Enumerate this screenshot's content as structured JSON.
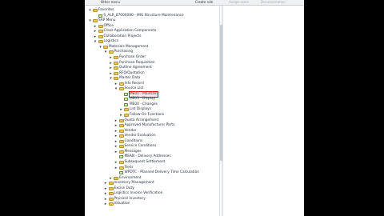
{
  "toolbar": {
    "buttons": [
      "Other menu",
      "Create role",
      "Assign users",
      "Documentation"
    ]
  },
  "tree": [
    {
      "label": "Favorites",
      "level": 0,
      "icon": "folder",
      "open": true
    },
    {
      "label": "S_ALR_87000080 - IMG Structure Maintenance",
      "level": 1,
      "icon": "transaction",
      "open": null
    },
    {
      "label": "SAP Menu",
      "level": 0,
      "icon": "folder",
      "open": true
    },
    {
      "label": "Office",
      "level": 1,
      "icon": "folder",
      "open": false
    },
    {
      "label": "Cross-Application Components",
      "level": 1,
      "icon": "folder",
      "open": false
    },
    {
      "label": "Collaboration Projects",
      "level": 1,
      "icon": "folder",
      "open": false
    },
    {
      "label": "Logistics",
      "level": 1,
      "icon": "folder",
      "open": true
    },
    {
      "label": "Materials Management",
      "level": 2,
      "icon": "folder",
      "open": true
    },
    {
      "label": "Purchasing",
      "level": 3,
      "icon": "folder",
      "open": true
    },
    {
      "label": "Purchase Order",
      "level": 4,
      "icon": "folder",
      "open": false
    },
    {
      "label": "Purchase Requisition",
      "level": 4,
      "icon": "folder",
      "open": false
    },
    {
      "label": "Outline Agreement",
      "level": 4,
      "icon": "folder",
      "open": false
    },
    {
      "label": "RFQ/Quotation",
      "level": 4,
      "icon": "folder",
      "open": false
    },
    {
      "label": "Master Data",
      "level": 4,
      "icon": "folder",
      "open": true
    },
    {
      "label": "Info Record",
      "level": 5,
      "icon": "folder",
      "open": false
    },
    {
      "label": "Source List",
      "level": 5,
      "icon": "folder",
      "open": true
    },
    {
      "label": "ME01 - Maintain",
      "level": 6,
      "icon": "transaction",
      "open": null,
      "selected": true
    },
    {
      "label": "ME03 - Display",
      "level": 6,
      "icon": "transaction",
      "open": null
    },
    {
      "label": "ME04 - Changes",
      "level": 6,
      "icon": "transaction",
      "open": null
    },
    {
      "label": "List Displays",
      "level": 6,
      "icon": "folder",
      "open": false
    },
    {
      "label": "Follow-On Functions",
      "level": 6,
      "icon": "folder",
      "open": false
    },
    {
      "label": "Quota Arrangement",
      "level": 5,
      "icon": "folder",
      "open": false
    },
    {
      "label": "Approved Manufacturer Parts",
      "level": 5,
      "icon": "folder",
      "open": false
    },
    {
      "label": "Vendor",
      "level": 5,
      "icon": "folder",
      "open": false
    },
    {
      "label": "Vendor Evaluation",
      "level": 5,
      "icon": "folder",
      "open": false
    },
    {
      "label": "Conditions",
      "level": 5,
      "icon": "folder",
      "open": false
    },
    {
      "label": "Service Conditions",
      "level": 5,
      "icon": "folder",
      "open": false
    },
    {
      "label": "Messages",
      "level": 5,
      "icon": "folder",
      "open": false
    },
    {
      "label": "MEAN - Delivery Addresses",
      "level": 5,
      "icon": "transaction",
      "open": null
    },
    {
      "label": "Subsequent Settlement",
      "level": 5,
      "icon": "folder",
      "open": false
    },
    {
      "label": "Texts",
      "level": 5,
      "icon": "folder",
      "open": false
    },
    {
      "label": "WPDTC - Planned Delivery Time Calculation",
      "level": 5,
      "icon": "transaction",
      "open": null
    },
    {
      "label": "Environment",
      "level": 4,
      "icon": "folder",
      "open": false
    },
    {
      "label": "Inventory Management",
      "level": 3,
      "icon": "folder",
      "open": false
    },
    {
      "label": "Excise Duty",
      "level": 3,
      "icon": "folder",
      "open": false
    },
    {
      "label": "Logistics Invoice Verification",
      "level": 3,
      "icon": "folder",
      "open": false
    },
    {
      "label": "Physical Inventory",
      "level": 3,
      "icon": "folder",
      "open": false
    },
    {
      "label": "Valuation",
      "level": 3,
      "icon": "folder",
      "open": false
    }
  ]
}
